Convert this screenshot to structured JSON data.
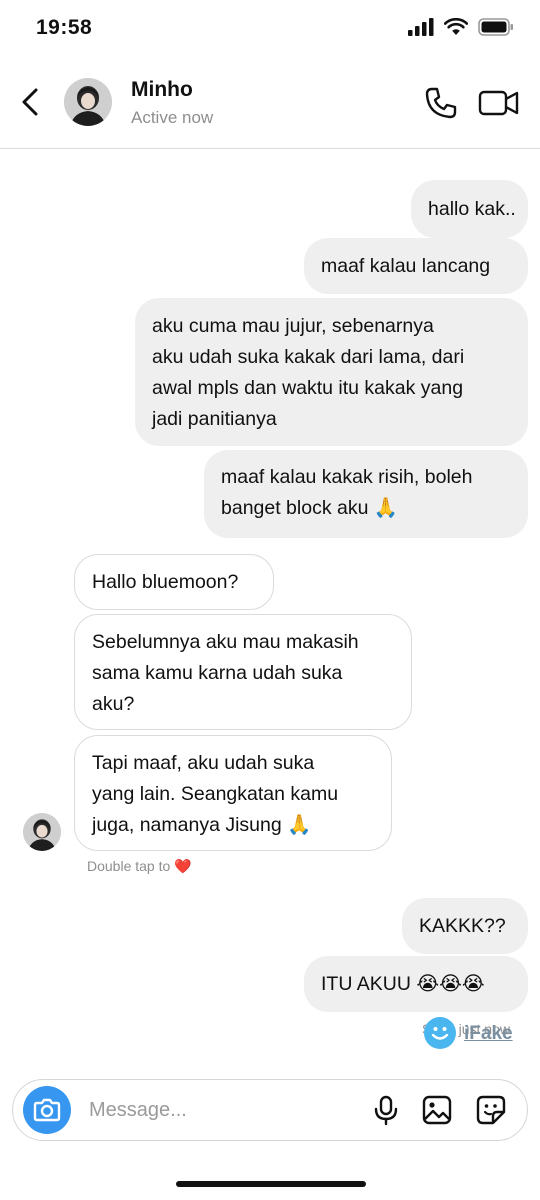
{
  "status_bar": {
    "time": "19:58"
  },
  "header": {
    "name": "Minho",
    "status": "Active now"
  },
  "messages": [
    {
      "dir": "out",
      "lines": [
        "hallo kak.."
      ]
    },
    {
      "dir": "out",
      "lines": [
        "maaf kalau lancang"
      ]
    },
    {
      "dir": "out",
      "lines": [
        "aku cuma mau jujur, sebenarnya",
        "aku udah suka kakak dari lama, dari",
        "awal mpls dan waktu itu kakak yang",
        "jadi panitianya"
      ]
    },
    {
      "dir": "out",
      "lines": [
        "maaf kalau kakak risih, boleh",
        "banget block aku 🙏"
      ]
    },
    {
      "dir": "in",
      "lines": [
        "Hallo bluemoon?"
      ]
    },
    {
      "dir": "in",
      "lines": [
        "Sebelumnya aku mau makasih",
        "sama kamu karna udah suka",
        "aku?"
      ]
    },
    {
      "dir": "in",
      "lines": [
        "Tapi maaf, aku udah suka",
        "yang lain. Seangkatan kamu",
        "juga, namanya Jisung 🙏"
      ]
    },
    {
      "dir": "out",
      "lines": [
        "KAKKK??"
      ]
    },
    {
      "dir": "out",
      "lines": [
        "ITU AKUU 😭😭😭"
      ]
    }
  ],
  "double_tap_hint": "Double tap to ❤️",
  "seen_label": "Seen just now",
  "watermark": "iFake",
  "composer": {
    "placeholder": "Message..."
  },
  "colors": {
    "outgoing_bubble": "#efefef",
    "incoming_border": "#dbdbdb",
    "camera_button": "#3797f0",
    "secondary_text": "#8e8e8e"
  }
}
